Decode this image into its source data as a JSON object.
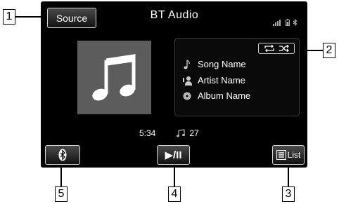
{
  "screen": {
    "title": "BT Audio",
    "source_label": "Source",
    "track": {
      "song": "Song Name",
      "artist": "Artist Name",
      "album": "Album Name",
      "elapsed": "5:34",
      "track_number": "27"
    },
    "controls": {
      "play_pause_label": "▶/II",
      "list_label": "List"
    },
    "icons": {
      "bluetooth": "bluetooth-icon",
      "repeat": "repeat-icon",
      "shuffle": "shuffle-icon",
      "signal": "signal-icon",
      "battery": "battery-icon",
      "album_art": "music-note-icon"
    }
  },
  "callouts": [
    "1",
    "2",
    "3",
    "4",
    "5"
  ],
  "colors": {
    "screen_bg": "#000000",
    "album_art_bg": "#5c5c5c",
    "button_border": "#d6d6d6"
  }
}
